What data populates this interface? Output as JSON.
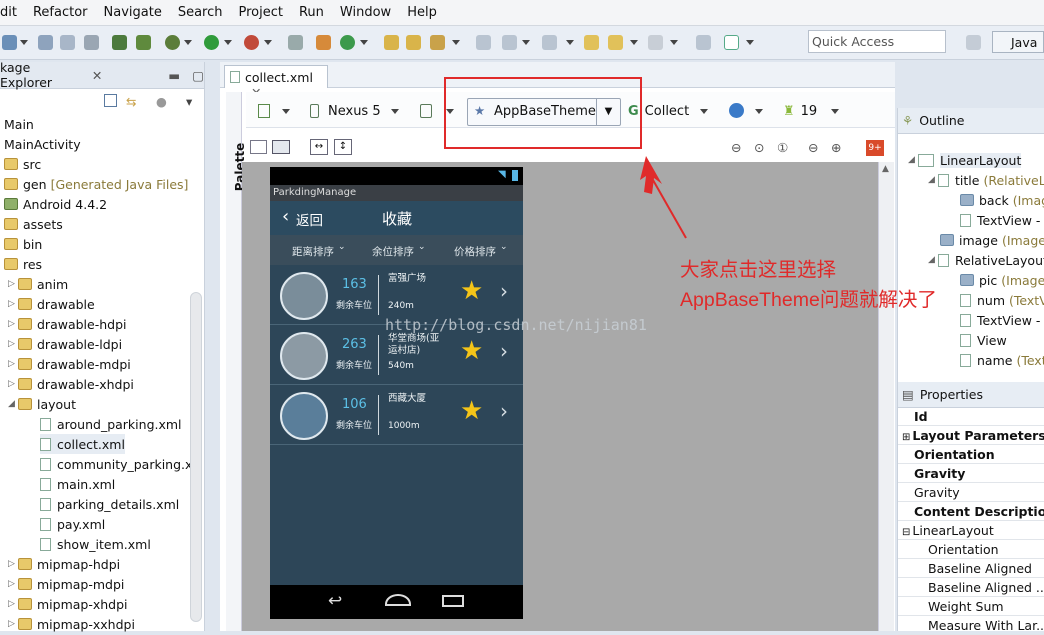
{
  "menubar": {
    "items": [
      "dit",
      "Refactor",
      "Navigate",
      "Search",
      "Project",
      "Run",
      "Window",
      "Help"
    ]
  },
  "toolbar": {
    "quick_access": "Quick Access",
    "perspective": "Java"
  },
  "package_explorer": {
    "title": "kage Explorer",
    "items": [
      "Main",
      "MainActivity",
      "src",
      "gen",
      "[Generated Java Files]",
      "Android 4.4.2",
      "assets",
      "bin",
      "res",
      "anim",
      "drawable",
      "drawable-hdpi",
      "drawable-ldpi",
      "drawable-mdpi",
      "drawable-xhdpi",
      "layout",
      "around_parking.xml",
      "collect.xml",
      "community_parking.x",
      "main.xml",
      "parking_details.xml",
      "pay.xml",
      "show_item.xml",
      "mipmap-hdpi",
      "mipmap-mdpi",
      "mipmap-xhdpi",
      "mipmap-xxhdpi"
    ]
  },
  "editor": {
    "tab": "collect.xml",
    "palette": "Palette",
    "device": "Nexus 5",
    "theme": "AppBaseTheme",
    "activity": "Collect",
    "api": "19",
    "error_badge": "9+"
  },
  "phone": {
    "app_title": "ParkdingManage",
    "back": "返回",
    "title": "收藏",
    "sorts": [
      "距离排序",
      "余位排序",
      "价格排序"
    ],
    "items": [
      {
        "num": "163",
        "sub": "剩余车位",
        "name": "富强广场",
        "dist": "240m"
      },
      {
        "num": "263",
        "sub": "剩余车位",
        "name": "华堂商场(亚运村店)",
        "dist": "540m"
      },
      {
        "num": "106",
        "sub": "剩余车位",
        "name": "西藏大厦",
        "dist": "1000m"
      }
    ]
  },
  "annotation": {
    "line1": "大家点击这里选择",
    "line2": "AppBaseTheme问题就解决了"
  },
  "watermark": "http://blog.csdn.net/nijian81",
  "outline": {
    "title": "Outline",
    "items": [
      "LinearLayout",
      "title",
      "(RelativeLa",
      "back",
      "(Imag",
      "TextView -",
      "image",
      "(ImageV",
      "RelativeLayout",
      "pic",
      "(Image",
      "num",
      "(TextV",
      "TextView -",
      "View",
      "name",
      "(Text"
    ]
  },
  "properties": {
    "title": "Properties",
    "rows": [
      "Id",
      "Layout Parameters",
      "Orientation",
      "Gravity",
      "Gravity",
      "Content Description",
      "LinearLayout",
      "Orientation",
      "Baseline Aligned",
      "Baseline Aligned ...",
      "Weight Sum",
      "Measure With Lar..."
    ]
  },
  "colors": {
    "accent": "#e02a2a",
    "phone_bg": "#2d4658",
    "number": "#5cc0e6"
  }
}
